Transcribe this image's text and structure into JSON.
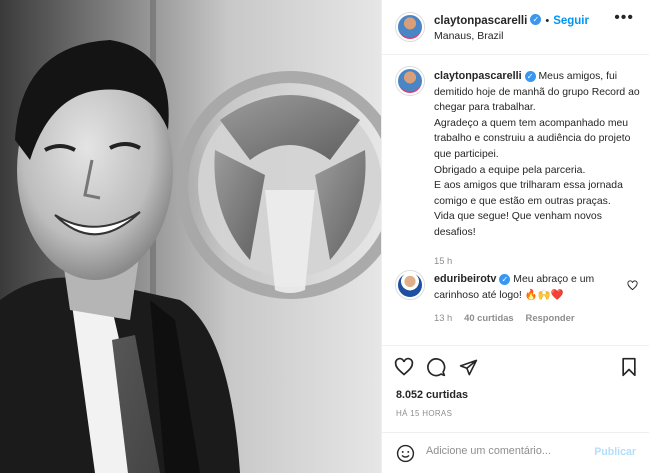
{
  "post": {
    "author": "claytonpascarelli",
    "follow_label": "Seguir",
    "separator": "•",
    "location": "Manaus, Brazil",
    "more_icon": "more-horizontal-icon"
  },
  "caption": {
    "author": "claytonpascarelli",
    "text_1": "Meus amigos, fui demitido hoje de manhã do grupo Record ao chegar para trabalhar.",
    "text_2": "Agradeço a quem tem acompanhado meu trabalho e construiu a audiência do projeto que participei.",
    "text_3": "Obrigado a equipe pela parceria.",
    "text_4": "E aos amigos que trilharam essa jornada comigo e que estão em outras praças.",
    "text_5": "Vida que segue! Que venham novos desafios!",
    "time": "15 h"
  },
  "comment": {
    "author": "eduribeirotv",
    "text": "Meu abraço e um carinhoso até logo!",
    "emoji": "🔥🙌❤️",
    "time": "13 h",
    "likes": "40 curtidas",
    "reply_label": "Responder"
  },
  "stats": {
    "likes": "8.052 curtidas",
    "timestamp": "HÁ 15 HORAS"
  },
  "composer": {
    "placeholder": "Adicione um comentário...",
    "publish_label": "Publicar"
  },
  "colors": {
    "link": "#0095f6",
    "verified": "#3897f0",
    "muted": "#8e8e8e",
    "publish_disabled": "#b2dffc"
  }
}
